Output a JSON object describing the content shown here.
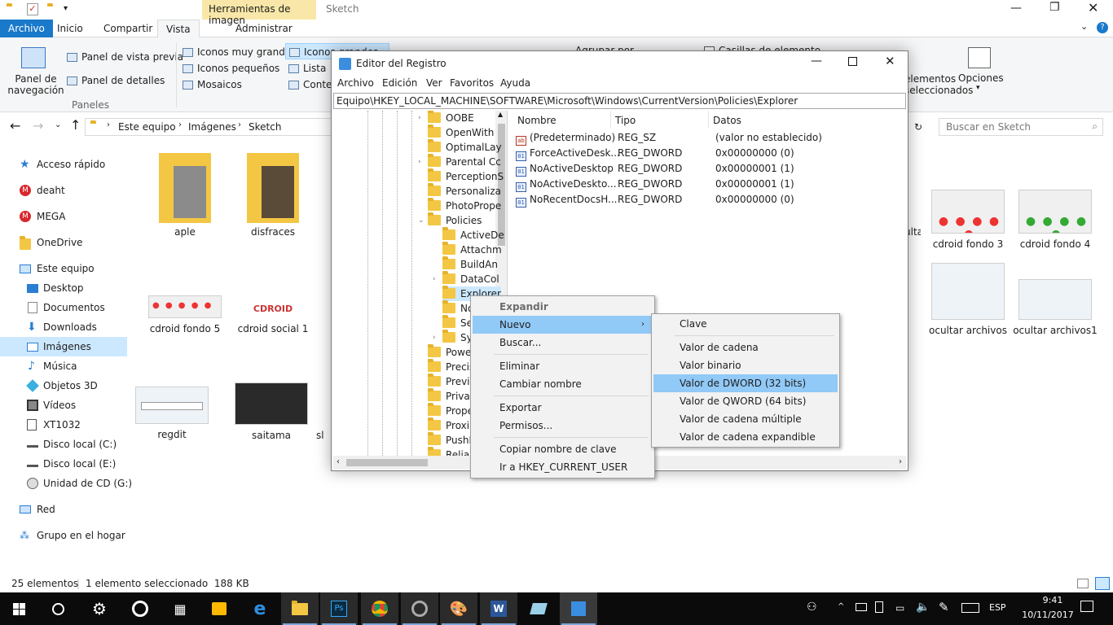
{
  "explorer": {
    "title": "Sketch",
    "contextual_tab": "Herramientas de imagen",
    "tabs": [
      "Archivo",
      "Inicio",
      "Compartir",
      "Vista",
      "Administrar"
    ],
    "ribbon": {
      "nav_pane": "Panel de\nnavegación",
      "preview": "Panel de vista previa",
      "details": "Panel de detalles",
      "group_panels": "Paneles",
      "layout": [
        "Iconos muy grandes",
        "Iconos grandes",
        "Iconos pequeños",
        "Lista",
        "Mosaicos",
        "Contenido"
      ],
      "group_by": "Agrupar por",
      "checkboxes": "Casillas de elemento",
      "hidden": "elementos\nseleccionados",
      "options": "Opciones"
    },
    "breadcrumb": [
      "Este equipo",
      "Imágenes",
      "Sketch"
    ],
    "search_placeholder": "Buscar en Sketch",
    "nav": [
      "Acceso rápido",
      "deaht",
      "MEGA",
      "OneDrive",
      "Este equipo",
      "Desktop",
      "Documentos",
      "Downloads",
      "Imágenes",
      "Música",
      "Objetos 3D",
      "Vídeos",
      "XT1032",
      "Disco local (C:)",
      "Disco local (E:)",
      "Unidad de CD (G:)",
      "Red",
      "Grupo en el hogar"
    ],
    "files": [
      "aple",
      "disfraces",
      "ulta",
      "cdroid fondo 3",
      "cdroid fondo 4",
      "cdroid fondo 5",
      "cdroid social 1",
      "ocultar archivos",
      "ocultar archivos1",
      "regdit",
      "saitama",
      "sl"
    ],
    "status": {
      "count": "25 elementos",
      "selected": "1 elemento seleccionado  188 KB"
    }
  },
  "regedit": {
    "title": "Editor del Registro",
    "menu": [
      "Archivo",
      "Edición",
      "Ver",
      "Favoritos",
      "Ayuda"
    ],
    "path": "Equipo\\HKEY_LOCAL_MACHINE\\SOFTWARE\\Microsoft\\Windows\\CurrentVersion\\Policies\\Explorer",
    "tree": [
      "OOBE",
      "OpenWith",
      "OptimalLay",
      "Parental Cc",
      "PerceptionS",
      "Personaliza",
      "PhotoPrope",
      "Policies",
      "ActiveDe",
      "Attachm",
      "BuildAn",
      "DataCol",
      "Explorer",
      "No",
      "Ser",
      "Sys",
      "Power",
      "Precis",
      "Previe",
      "Privac",
      "Prope",
      "Proxin",
      "PushN",
      "Reliab"
    ],
    "columns": [
      "Nombre",
      "Tipo",
      "Datos"
    ],
    "values": [
      {
        "name": "(Predeterminado)",
        "type": "REG_SZ",
        "data": "(valor no establecido)",
        "icon": "ab"
      },
      {
        "name": "ForceActiveDesk...",
        "type": "REG_DWORD",
        "data": "0x00000000 (0)",
        "icon": "bin"
      },
      {
        "name": "NoActiveDesktop",
        "type": "REG_DWORD",
        "data": "0x00000001 (1)",
        "icon": "bin"
      },
      {
        "name": "NoActiveDeskto...",
        "type": "REG_DWORD",
        "data": "0x00000001 (1)",
        "icon": "bin"
      },
      {
        "name": "NoRecentDocsH...",
        "type": "REG_DWORD",
        "data": "0x00000000 (0)",
        "icon": "bin"
      }
    ]
  },
  "context_menu": [
    "Expandir",
    "Nuevo",
    "Buscar...",
    "Eliminar",
    "Cambiar nombre",
    "Exportar",
    "Permisos...",
    "Copiar nombre de clave",
    "Ir a HKEY_CURRENT_USER"
  ],
  "submenu": [
    "Clave",
    "Valor de cadena",
    "Valor binario",
    "Valor de DWORD (32 bits)",
    "Valor de QWORD (64 bits)",
    "Valor de cadena múltiple",
    "Valor de cadena expandible"
  ],
  "taskbar": {
    "time": "9:41",
    "date": "10/11/2017",
    "lang": "ESP"
  },
  "colors": {
    "accent": "#1979ca",
    "menu_highlight": "#91c9f7",
    "nav_selected": "#cce8ff"
  }
}
